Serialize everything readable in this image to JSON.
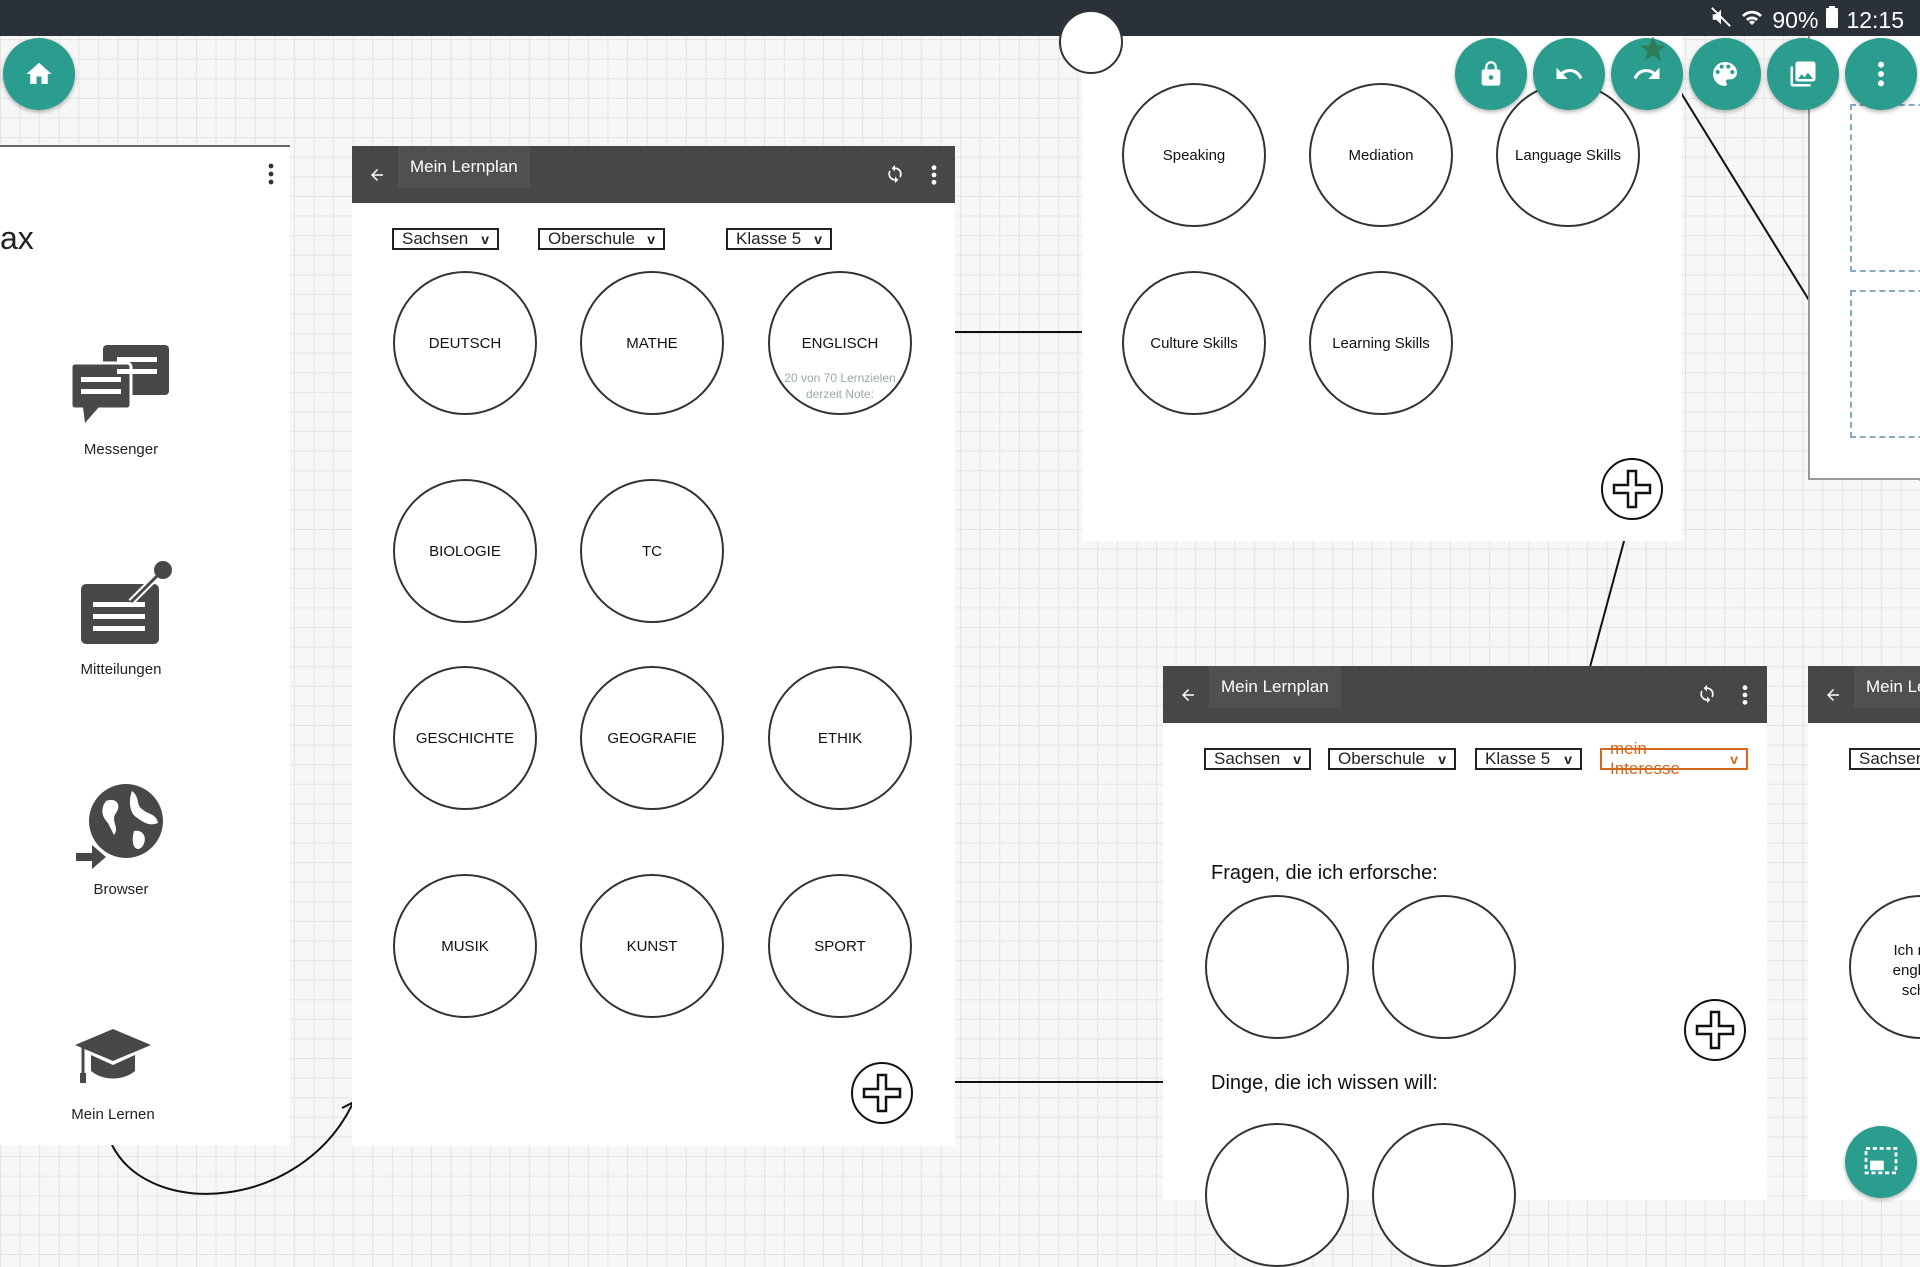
{
  "status": {
    "battery": "90%",
    "time": "12:15"
  },
  "sidebar": {
    "title_fragment": "ax",
    "items": [
      {
        "label": "Messenger"
      },
      {
        "label": "Mitteilungen"
      },
      {
        "label": "Browser"
      },
      {
        "label": "Mein Lernen"
      }
    ]
  },
  "window1": {
    "title": "Mein Lernplan",
    "filters": [
      "Sachsen",
      "Oberschule",
      "Klasse 5"
    ],
    "subjects": [
      "DEUTSCH",
      "MATHE",
      "ENGLISCH",
      "BIOLOGIE",
      "TC",
      "GESCHICHTE",
      "GEOGRAFIE",
      "ETHIK",
      "MUSIK",
      "KUNST",
      "SPORT"
    ],
    "englisch_progress": "20 von 70 Lernzielen",
    "englisch_grade": "derzeit Note:"
  },
  "skills": [
    "Speaking",
    "Mediation",
    "Language Skills",
    "Culture Skills",
    "Learning Skills"
  ],
  "window2": {
    "title": "Mein Lernplan",
    "filters": [
      "Sachsen",
      "Oberschule",
      "Klasse 5",
      "mein Interesse"
    ],
    "heading1": "Fragen, die ich erforsche:",
    "heading2": "Dinge, die ich wissen will:"
  },
  "window3": {
    "title": "Mein Ler",
    "filter": "Sachsen",
    "note_line1": "Ich mö",
    "note_line2": "englisc",
    "note_line3": "schr"
  },
  "colors": {
    "accent": "#2a9d8f",
    "interest": "#d2691e",
    "winbar": "#474747"
  }
}
